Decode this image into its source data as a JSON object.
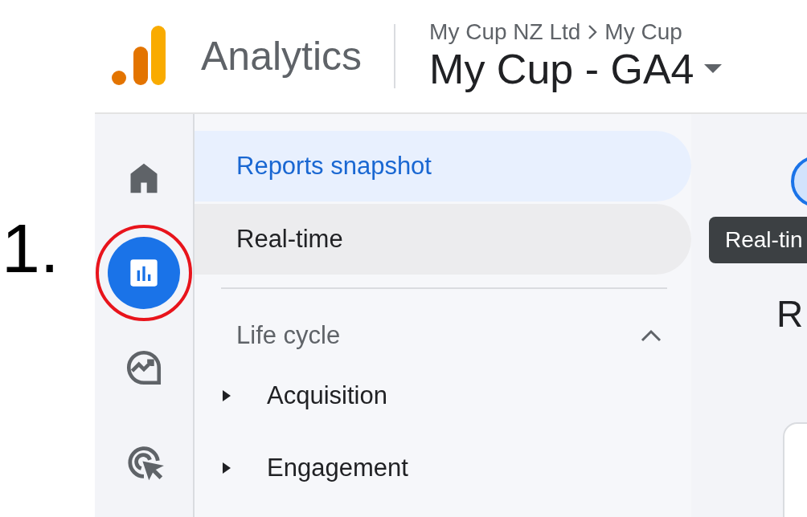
{
  "annotation": {
    "step": "1."
  },
  "header": {
    "product": "Analytics",
    "breadcrumb": [
      "My Cup NZ Ltd",
      "My Cup"
    ],
    "property": "My Cup - GA4"
  },
  "rail": [
    {
      "kind": "home",
      "selected": false,
      "highlighted": false
    },
    {
      "kind": "reports",
      "selected": true,
      "highlighted": true
    },
    {
      "kind": "explore",
      "selected": false,
      "highlighted": false
    },
    {
      "kind": "advertising",
      "selected": false,
      "highlighted": false
    }
  ],
  "nav": {
    "items": [
      {
        "label": "Reports snapshot",
        "selected": true,
        "hovered": false
      },
      {
        "label": "Real-time",
        "selected": false,
        "hovered": true
      }
    ],
    "section": {
      "label": "Life cycle",
      "expanded": true,
      "children": [
        {
          "label": "Acquisition",
          "expanded": false
        },
        {
          "label": "Engagement",
          "expanded": false
        }
      ]
    }
  },
  "tooltip": {
    "text": "Real-tin"
  },
  "main": {
    "heading": "R"
  }
}
